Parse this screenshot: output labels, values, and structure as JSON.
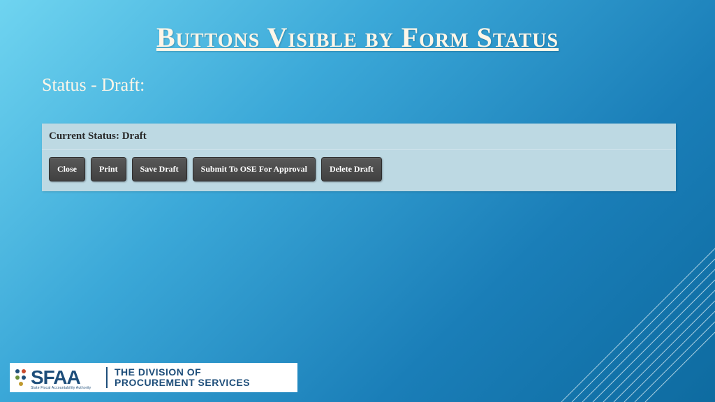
{
  "title": "Buttons Visible by Form Status",
  "subtitle": "Status - Draft:",
  "panel": {
    "status_label": "Current Status: Draft",
    "buttons": {
      "close": "Close",
      "print": "Print",
      "save_draft": "Save Draft",
      "submit": "Submit To OSE For Approval",
      "delete_draft": "Delete Draft"
    }
  },
  "footer": {
    "logo_abbr": "SFAA",
    "logo_sub": "State Fiscal Accountability Authority",
    "division_line1": "The Division of",
    "division_line2": "Procurement Services"
  }
}
